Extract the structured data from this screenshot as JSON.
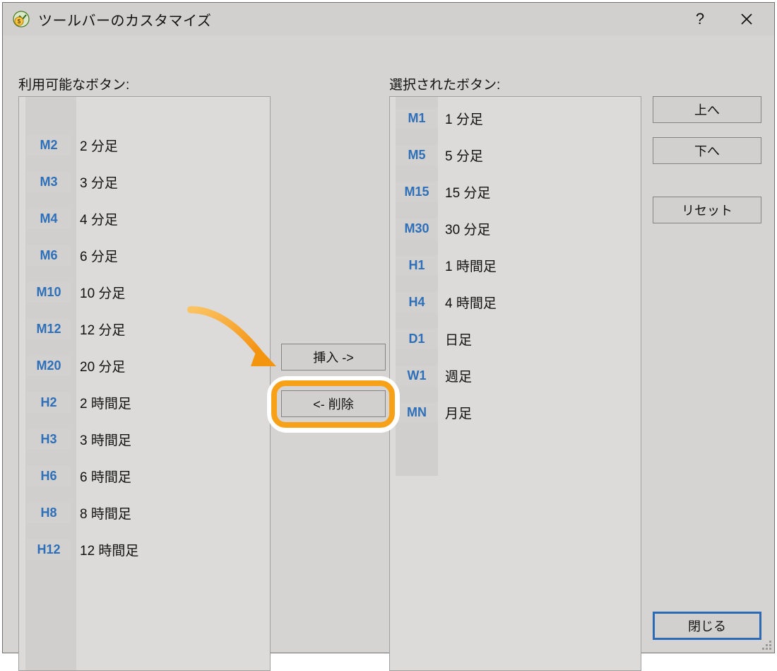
{
  "titlebar": {
    "title": "ツールバーのカスタマイズ",
    "help_tooltip": "?",
    "close_tooltip": "閉じる"
  },
  "labels": {
    "available": "利用可能なボタン:",
    "selected": "選択されたボタン:"
  },
  "available_buttons": [
    {
      "code": "M2",
      "desc": "2 分足"
    },
    {
      "code": "M3",
      "desc": "3 分足"
    },
    {
      "code": "M4",
      "desc": "4 分足"
    },
    {
      "code": "M6",
      "desc": "6 分足"
    },
    {
      "code": "M10",
      "desc": "10 分足"
    },
    {
      "code": "M12",
      "desc": "12 分足"
    },
    {
      "code": "M20",
      "desc": "20 分足"
    },
    {
      "code": "H2",
      "desc": "2 時間足"
    },
    {
      "code": "H3",
      "desc": "3 時間足"
    },
    {
      "code": "H6",
      "desc": "6 時間足"
    },
    {
      "code": "H8",
      "desc": "8 時間足"
    },
    {
      "code": "H12",
      "desc": "12 時間足"
    }
  ],
  "selected_buttons": [
    {
      "code": "M1",
      "desc": "1 分足"
    },
    {
      "code": "M5",
      "desc": "5 分足"
    },
    {
      "code": "M15",
      "desc": "15 分足"
    },
    {
      "code": "M30",
      "desc": "30 分足"
    },
    {
      "code": "H1",
      "desc": "1 時間足"
    },
    {
      "code": "H4",
      "desc": "4 時間足"
    },
    {
      "code": "D1",
      "desc": "日足"
    },
    {
      "code": "W1",
      "desc": "週足"
    },
    {
      "code": "MN",
      "desc": "月足"
    }
  ],
  "buttons": {
    "insert": "挿入 ->",
    "remove": "<- 削除",
    "up": "上へ",
    "down": "下へ",
    "reset": "リセット",
    "close": "閉じる"
  }
}
